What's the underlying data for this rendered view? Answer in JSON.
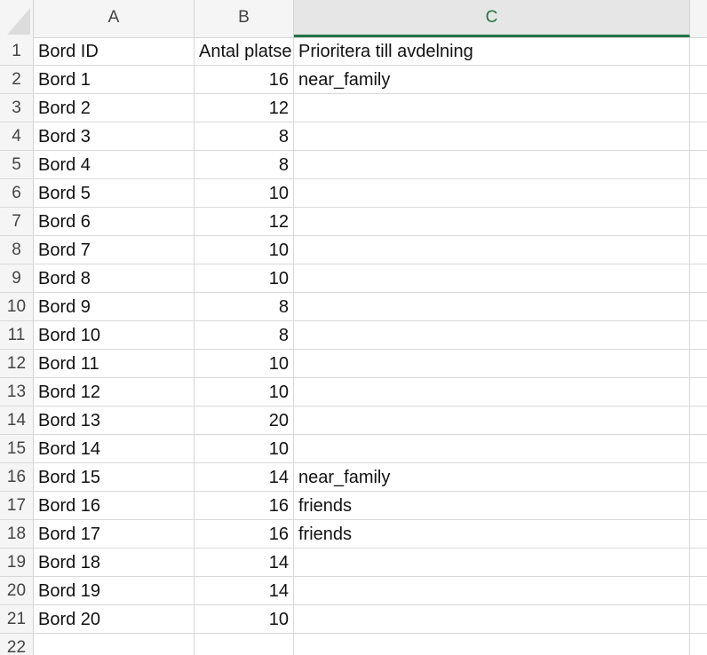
{
  "columns": [
    {
      "letter": "A"
    },
    {
      "letter": "B"
    },
    {
      "letter": "C"
    }
  ],
  "rows": [
    {
      "num": "1",
      "a": "Bord ID",
      "b": "Antal platse",
      "c": "Prioritera till avdelning"
    },
    {
      "num": "2",
      "a": "Bord 1",
      "b": "16",
      "c": "near_family"
    },
    {
      "num": "3",
      "a": "Bord 2",
      "b": "12",
      "c": ""
    },
    {
      "num": "4",
      "a": "Bord 3",
      "b": "8",
      "c": ""
    },
    {
      "num": "5",
      "a": "Bord 4",
      "b": "8",
      "c": ""
    },
    {
      "num": "6",
      "a": "Bord 5",
      "b": "10",
      "c": ""
    },
    {
      "num": "7",
      "a": "Bord 6",
      "b": "12",
      "c": ""
    },
    {
      "num": "8",
      "a": "Bord 7",
      "b": "10",
      "c": ""
    },
    {
      "num": "9",
      "a": "Bord 8",
      "b": "10",
      "c": ""
    },
    {
      "num": "10",
      "a": "Bord 9",
      "b": "8",
      "c": ""
    },
    {
      "num": "11",
      "a": "Bord 10",
      "b": "8",
      "c": ""
    },
    {
      "num": "12",
      "a": "Bord 11",
      "b": "10",
      "c": ""
    },
    {
      "num": "13",
      "a": "Bord 12",
      "b": "10",
      "c": ""
    },
    {
      "num": "14",
      "a": "Bord 13",
      "b": "20",
      "c": ""
    },
    {
      "num": "15",
      "a": "Bord 14",
      "b": "10",
      "c": ""
    },
    {
      "num": "16",
      "a": "Bord 15",
      "b": "14",
      "c": "near_family"
    },
    {
      "num": "17",
      "a": "Bord 16",
      "b": "16",
      "c": "friends"
    },
    {
      "num": "18",
      "a": "Bord 17",
      "b": "16",
      "c": "friends"
    },
    {
      "num": "19",
      "a": "Bord 18",
      "b": "14",
      "c": ""
    },
    {
      "num": "20",
      "a": "Bord 19",
      "b": "14",
      "c": ""
    },
    {
      "num": "21",
      "a": "Bord 20",
      "b": "10",
      "c": ""
    },
    {
      "num": "22",
      "a": "",
      "b": "",
      "c": ""
    }
  ],
  "selected_column": "C",
  "colors": {
    "accent": "#217346",
    "header_bg": "#f5f5f5",
    "grid": "#d9d9d9"
  }
}
